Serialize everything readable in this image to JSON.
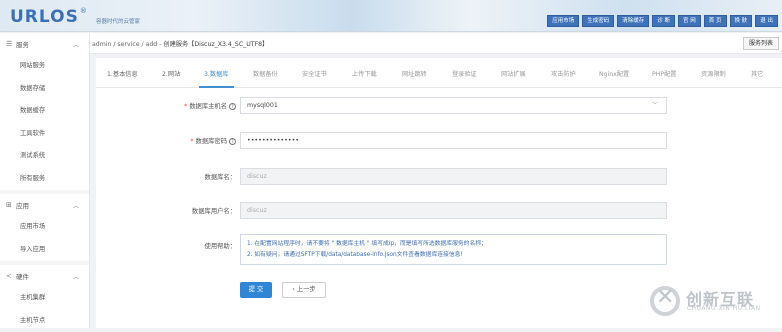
{
  "header": {
    "logo": "URLOS",
    "logo_mark": "®",
    "tagline": "容器时代的云管家",
    "nav": [
      "应用市场",
      "生成密码",
      "清除缓存",
      "诊 断",
      "官 网",
      "首 页",
      "换 肤",
      "退 出"
    ]
  },
  "sidebar": {
    "groups": [
      {
        "icon": "☰",
        "label": "服务",
        "items": [
          "网站服务",
          "数据存储",
          "数据缓存",
          "工具软件",
          "测试系统",
          "所有服务"
        ]
      },
      {
        "icon": "⊞",
        "label": "应用",
        "items": [
          "应用市场",
          "导入应用"
        ]
      },
      {
        "icon": "≺",
        "label": "硬件",
        "items": [
          "主机集群",
          "主机节点"
        ]
      }
    ]
  },
  "breadcrumb": {
    "path": "admin / service / add - ",
    "title": "创建服务【Discuz_X3.4_SC_UTF8】"
  },
  "service_list_button": "服务列表",
  "tabs": [
    "1.基本信息",
    "2.网站",
    "3.数据库",
    "数据备份",
    "安全证书",
    "上传下载",
    "网址跳转",
    "登录验证",
    "网站扩展",
    "攻击防护",
    "Nginx配置",
    "PHP配置",
    "资源限制",
    "其它"
  ],
  "active_tab": 2,
  "form": {
    "db_host_label": "数据库主机名",
    "db_host_value": "mysql001",
    "db_password_label": "数据库密码",
    "db_password_value": "••••••••••••••",
    "db_name_label": "数据库名：",
    "db_name_value": "discuz",
    "db_user_label": "数据库用户名：",
    "db_user_value": "discuz",
    "help_label": "使用帮助：",
    "help_lines": [
      "1. 在配置网站程序时，请不要将 \" 数据库主机 \" 填写成ip，而是填写所选数据库服务的名称；",
      "2. 如有疑问，请通过SFTP下载/data/database-info.json文件查看数据库连接信息!"
    ],
    "submit": "提 交",
    "prev": "‹  上一步"
  },
  "watermark": {
    "cn": "创新互联",
    "en": "CHUANG XIN HU LIAN"
  },
  "colors": {
    "accent": "#2f86d6",
    "header_button": "#3f72b8",
    "required": "#e54b4b"
  }
}
